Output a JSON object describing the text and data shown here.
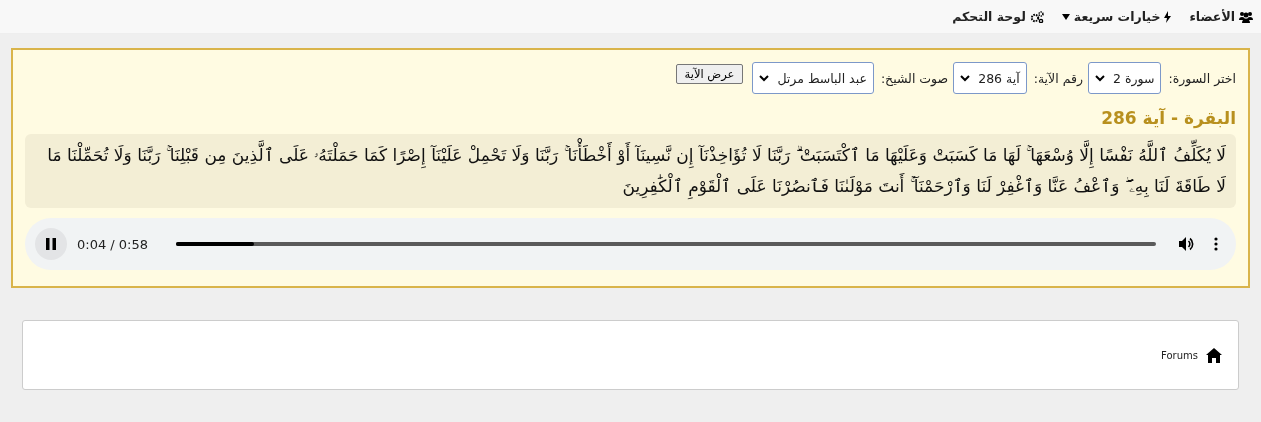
{
  "nav": [
    {
      "label": "الأعضاء",
      "dropdown": false
    },
    {
      "label": "خيارات سريعة",
      "dropdown": true
    },
    {
      "label": "لوحة التحكم",
      "dropdown": false
    }
  ],
  "selector": {
    "surah_label": "اختر السورة:",
    "surah_value": "سورة 2",
    "ayah_label": "رقم الآية:",
    "ayah_value": "آية 286",
    "reciter_label": "صوت الشيخ:",
    "reciter_value": "عبد الباسط مرتل",
    "button": "عرض الآية"
  },
  "heading": "البقرة - آية 286",
  "verse": "لَا يُكَلِّفُ ٱللَّهُ نَفْسًا إِلَّا وُسْعَهَا ۚ لَهَا مَا كَسَبَتْ وَعَلَيْهَا مَا ٱكْتَسَبَتْ ۗ رَبَّنَا لَا تُؤَاخِذْنَآ إِن نَّسِينَآ أَوْ أَخْطَأْنَا ۚ رَبَّنَا وَلَا تَحْمِلْ عَلَيْنَآ إِصْرًا كَمَا حَمَلْتَهُۥ عَلَى ٱلَّذِينَ مِن قَبْلِنَا ۚ رَبَّنَا وَلَا تُحَمِّلْنَا مَا لَا طَاقَةَ لَنَا بِهِۦ ۖ وَٱعْفُ عَنَّا وَٱغْفِرْ لَنَا وَٱرْحَمْنَآ ۚ أَنتَ مَوْلَىٰنَا فَٱنصُرْنَا عَلَى ٱلْقَوْمِ ٱلْكَٰفِرِينَ",
  "player": {
    "playing": true,
    "time": "0:04 / 0:58",
    "level": 0.08
  },
  "footer": {
    "link": "Forums"
  }
}
